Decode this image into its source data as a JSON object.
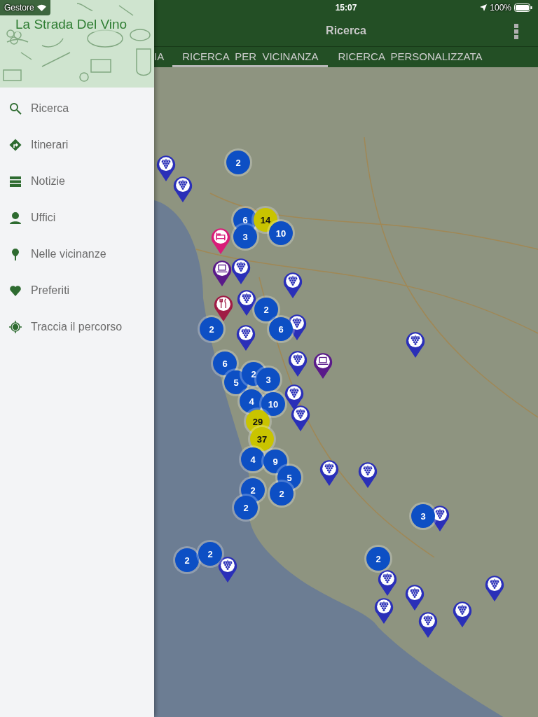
{
  "status_bar": {
    "carrier": "Gestore",
    "time": "15:07",
    "battery": "100%"
  },
  "drawer": {
    "app_title": "La Strada Del Vino",
    "items": [
      {
        "label": "Ricerca",
        "kind": "search"
      },
      {
        "label": "Itinerari",
        "kind": "route"
      },
      {
        "label": "Notizie",
        "kind": "news"
      },
      {
        "label": "Uffici",
        "kind": "office"
      },
      {
        "label": "Nelle vicinanze",
        "kind": "nearby"
      },
      {
        "label": "Preferiti",
        "kind": "favorite"
      },
      {
        "label": "Traccia il percorso",
        "kind": "track"
      }
    ]
  },
  "toolbar": {
    "title": "Ricerca"
  },
  "tabs": [
    {
      "label": "IA",
      "selected": false
    },
    {
      "label": "RICERCA  PER  VICINANZA",
      "selected": true
    },
    {
      "label": "RICERCA  PERSONALIZZATA",
      "selected": false
    }
  ],
  "map": {
    "clusters": [
      {
        "count": "2",
        "kind": "small"
      },
      {
        "count": "6",
        "kind": "small"
      },
      {
        "count": "3",
        "kind": "small"
      },
      {
        "count": "14",
        "kind": "large"
      },
      {
        "count": "10",
        "kind": "small"
      },
      {
        "count": "2",
        "kind": "small"
      },
      {
        "count": "2",
        "kind": "small"
      },
      {
        "count": "6",
        "kind": "small"
      },
      {
        "count": "6",
        "kind": "small"
      },
      {
        "count": "5",
        "kind": "small"
      },
      {
        "count": "2",
        "kind": "small"
      },
      {
        "count": "3",
        "kind": "small"
      },
      {
        "count": "4",
        "kind": "small"
      },
      {
        "count": "10",
        "kind": "small"
      },
      {
        "count": "29",
        "kind": "large"
      },
      {
        "count": "37",
        "kind": "large"
      },
      {
        "count": "4",
        "kind": "small"
      },
      {
        "count": "9",
        "kind": "small"
      },
      {
        "count": "5",
        "kind": "small"
      },
      {
        "count": "2",
        "kind": "small"
      },
      {
        "count": "2",
        "kind": "small"
      },
      {
        "count": "2",
        "kind": "small"
      },
      {
        "count": "3",
        "kind": "small"
      },
      {
        "count": "2",
        "kind": "small"
      },
      {
        "count": "2",
        "kind": "small"
      },
      {
        "count": "2",
        "kind": "small"
      }
    ],
    "pins": [
      {
        "kind": "winery"
      },
      {
        "kind": "winery"
      },
      {
        "kind": "hotel"
      },
      {
        "kind": "computer"
      },
      {
        "kind": "winery"
      },
      {
        "kind": "winery"
      },
      {
        "kind": "restaurant"
      },
      {
        "kind": "winery"
      },
      {
        "kind": "winery"
      },
      {
        "kind": "winery"
      },
      {
        "kind": "computer"
      },
      {
        "kind": "winery"
      },
      {
        "kind": "winery"
      },
      {
        "kind": "winery"
      },
      {
        "kind": "winery"
      },
      {
        "kind": "winery"
      },
      {
        "kind": "winery"
      },
      {
        "kind": "winery"
      },
      {
        "kind": "winery"
      },
      {
        "kind": "winery"
      },
      {
        "kind": "winery"
      },
      {
        "kind": "winery"
      },
      {
        "kind": "winery"
      },
      {
        "kind": "winery"
      },
      {
        "kind": "winery"
      }
    ]
  }
}
